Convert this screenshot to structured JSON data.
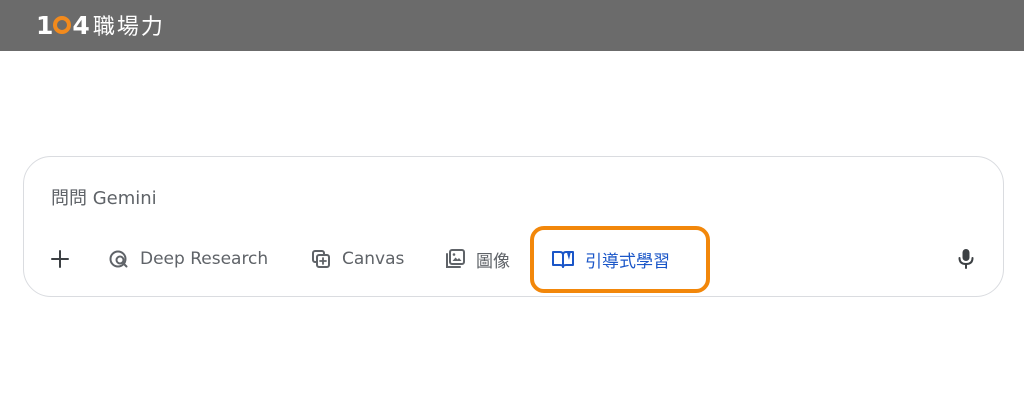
{
  "header": {
    "logo_text_pre": "1",
    "logo_text_post": "4",
    "brand_name": "職場力",
    "background": "#6b6b6b",
    "logo_accent": "#f28a1d"
  },
  "composer": {
    "placeholder": "問問 Gemini"
  },
  "toolbar": {
    "add_icon": "plus-icon",
    "items": [
      {
        "label": "Deep Research",
        "icon": "deep-research-icon"
      },
      {
        "label": "Canvas",
        "icon": "canvas-icon"
      },
      {
        "label": "圖像",
        "icon": "image-gallery-icon"
      },
      {
        "label": "引導式學習",
        "icon": "open-book-icon",
        "color": "#1a56c8"
      }
    ],
    "mic_icon": "microphone-icon"
  },
  "annotation": {
    "highlight_color": "#f2870a"
  }
}
